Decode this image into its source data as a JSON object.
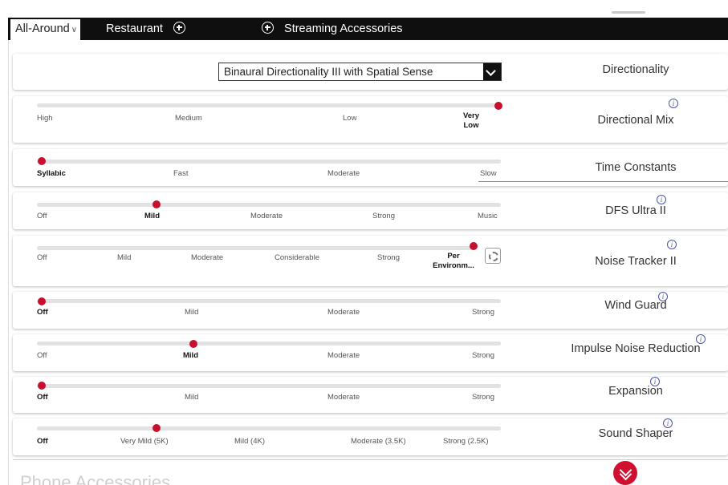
{
  "tabs": {
    "all_around": "All-Around",
    "restaurant": "Restaurant",
    "streaming": "Streaming Accessories"
  },
  "directionality": {
    "label": "Directionality",
    "selected": "Binaural Directionality III with Spatial Sense"
  },
  "directional_mix": {
    "label": "Directional Mix",
    "options": [
      "High",
      "Medium",
      "Low",
      "Very Low"
    ],
    "selected": "Very Low"
  },
  "time_constants": {
    "label": "Time Constants",
    "options": [
      "Syllabic",
      "Fast",
      "Moderate",
      "Slow"
    ],
    "selected": "Syllabic"
  },
  "dfs": {
    "label": "DFS Ultra II",
    "options": [
      "Off",
      "Mild",
      "Moderate",
      "Strong",
      "Music"
    ],
    "selected": "Mild"
  },
  "noise_tracker": {
    "label": "Noise Tracker II",
    "options": [
      "Off",
      "Mild",
      "Moderate",
      "Considerable",
      "Strong",
      "Per Environm..."
    ],
    "selected": "Per Environm..."
  },
  "wind_guard": {
    "label": "Wind Guard",
    "options": [
      "Off",
      "Mild",
      "Moderate",
      "Strong"
    ],
    "selected": "Off"
  },
  "impulse": {
    "label": "Impulse Noise Reduction",
    "options": [
      "Off",
      "Mild",
      "Moderate",
      "Strong"
    ],
    "selected": "Mild"
  },
  "expansion": {
    "label": "Expansion",
    "options": [
      "Off",
      "Mild",
      "Moderate",
      "Strong"
    ],
    "selected": "Off"
  },
  "sound_shaper": {
    "label": "Sound Shaper",
    "options": [
      "Off",
      "Very Mild (5K)",
      "Mild (4K)",
      "Moderate (3.5K)",
      "Strong (2.5K)"
    ],
    "selected": "Very Mild (5K)"
  },
  "bottom": {
    "title": "Phone Accessories"
  },
  "icons": {
    "info": "info-icon",
    "add": "add-circle-icon",
    "settings": "gear-icon",
    "expand": "double-chevron-down-icon",
    "dropdown": "chevron-down-icon"
  },
  "colors": {
    "accent": "#c8102e",
    "tab_bar": "#0f0f0f",
    "info": "#4a55a8"
  }
}
